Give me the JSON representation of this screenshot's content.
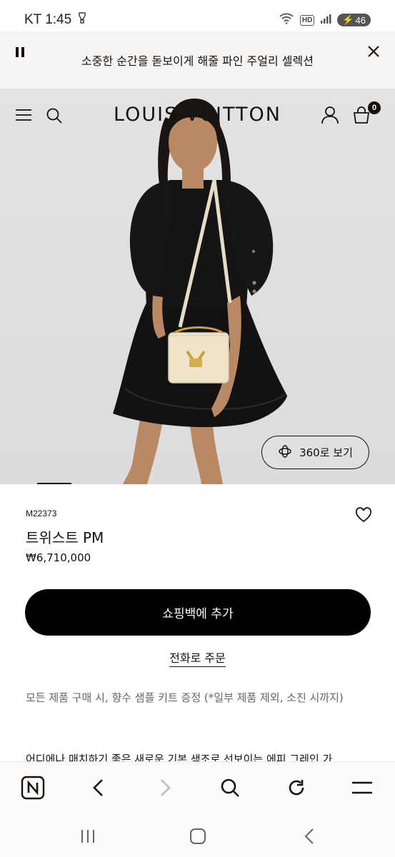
{
  "status_bar": {
    "carrier_time": "KT 1:45",
    "network": "HD",
    "battery": "46"
  },
  "announcement": {
    "message": "소중한 순간을 돋보이게 해줄 파인 주얼리 셀렉션"
  },
  "header": {
    "brand": "LOUIS VUITTON",
    "bag_count": "0"
  },
  "hero": {
    "view360_label": "360로 보기"
  },
  "product": {
    "sku": "M22373",
    "name": "트위스트 PM",
    "price": "₩6,710,000",
    "add_to_bag": "쇼핑백에 추가",
    "phone_order": "전화로 주문",
    "gift_note": "모든 제품 구매 시, 향수 샘플 키트 증정 (*일부 제품 제외, 소진 시까지)",
    "description_partial": "어디에나 매치하기 좋은 새로운 기본 색조로 선보이는 에피 그레인 가"
  },
  "colors": {
    "accent": "#19110b",
    "button_bg": "#000000",
    "hero_bg": "#e0e0e2"
  }
}
